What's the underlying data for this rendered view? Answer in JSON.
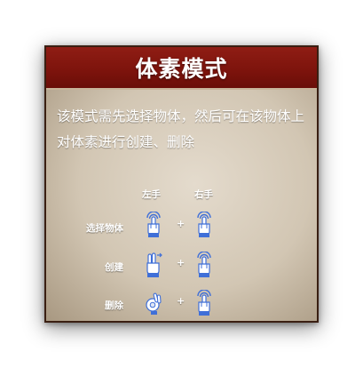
{
  "dialog": {
    "title": "体素模式",
    "description": "该模式需先选择物体，然后可在该物体上对体素进行创建、删除"
  },
  "controls": {
    "left_hand_header": "左手",
    "right_hand_header": "右手",
    "plus_sign": "+",
    "rows": [
      {
        "label": "选择物体",
        "left_gesture": "index-tap-gesture-icon",
        "right_gesture": "index-tap-gesture-icon"
      },
      {
        "label": "创建",
        "left_gesture": "two-finger-swipe-gesture-icon",
        "right_gesture": "index-tap-gesture-icon"
      },
      {
        "label": "删除",
        "left_gesture": "ok-gesture-icon",
        "right_gesture": "index-tap-gesture-icon"
      }
    ]
  },
  "colors": {
    "title_bar": "#7c130c",
    "panel_border": "#3a1f12",
    "panel_bg": "#d2c6b3",
    "gesture_blue": "#3f6fd8",
    "text": "#ffffff"
  }
}
